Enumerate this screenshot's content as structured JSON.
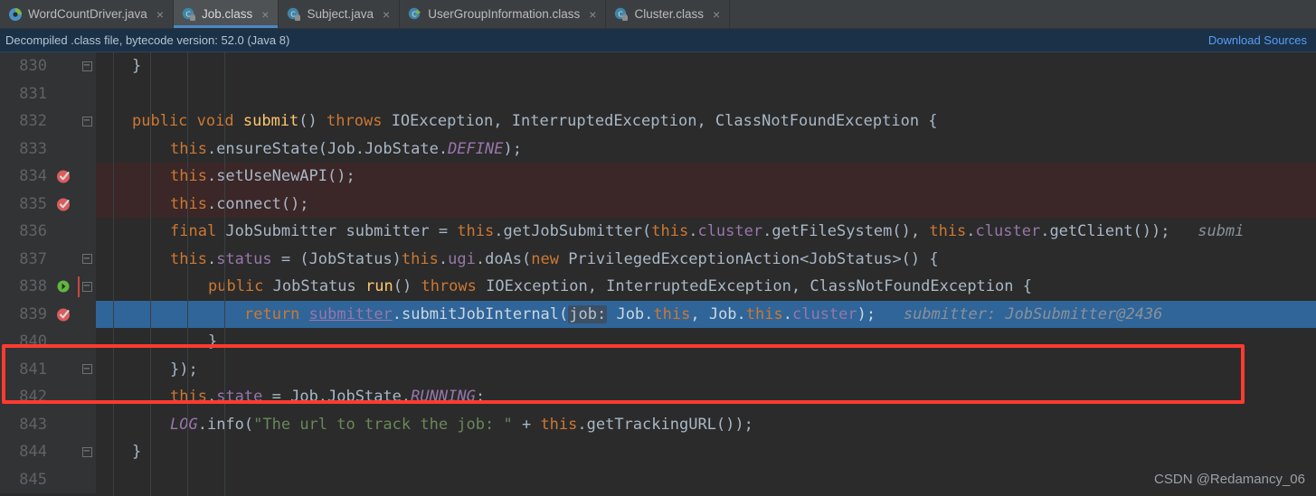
{
  "tabs": [
    {
      "label": "WordCountDriver.java",
      "icon": "java-file-icon",
      "active": false,
      "close": "×"
    },
    {
      "label": "Job.class",
      "icon": "class-file-icon",
      "active": true,
      "close": "×"
    },
    {
      "label": "Subject.java",
      "icon": "class-file-icon",
      "active": false,
      "close": "×"
    },
    {
      "label": "UserGroupInformation.class",
      "icon": "class-file-icon",
      "active": false,
      "close": "×"
    },
    {
      "label": "Cluster.class",
      "icon": "class-file-icon",
      "active": false,
      "close": "×"
    }
  ],
  "banner": {
    "message": "Decompiled .class file, bytecode version: 52.0 (Java 8)",
    "action_label": "Download Sources"
  },
  "editor": {
    "file": "Job.class",
    "first_line": 830,
    "lines": [
      {
        "n": "830",
        "fold": "minus",
        "breakpoint": null,
        "state": "normal"
      },
      {
        "n": "831",
        "fold": null,
        "breakpoint": null,
        "state": "normal"
      },
      {
        "n": "832",
        "fold": "minus",
        "breakpoint": null,
        "state": "normal"
      },
      {
        "n": "833",
        "fold": null,
        "breakpoint": null,
        "state": "normal"
      },
      {
        "n": "834",
        "fold": null,
        "breakpoint": "verified-red",
        "state": "error"
      },
      {
        "n": "835",
        "fold": null,
        "breakpoint": "verified-red",
        "state": "error"
      },
      {
        "n": "836",
        "fold": null,
        "breakpoint": null,
        "state": "normal"
      },
      {
        "n": "837",
        "fold": "minus",
        "breakpoint": null,
        "state": "normal"
      },
      {
        "n": "838",
        "fold": "minus",
        "breakpoint": "verified-green",
        "state": "normal"
      },
      {
        "n": "839",
        "fold": null,
        "breakpoint": "verified-red",
        "state": "selected"
      },
      {
        "n": "840",
        "fold": null,
        "breakpoint": null,
        "state": "normal"
      },
      {
        "n": "841",
        "fold": "minus",
        "breakpoint": null,
        "state": "normal"
      },
      {
        "n": "842",
        "fold": null,
        "breakpoint": null,
        "state": "normal"
      },
      {
        "n": "843",
        "fold": null,
        "breakpoint": null,
        "state": "normal"
      },
      {
        "n": "844",
        "fold": "minus",
        "breakpoint": null,
        "state": "normal"
      },
      {
        "n": "845",
        "fold": null,
        "breakpoint": null,
        "state": "normal"
      }
    ],
    "code": {
      "l830": "}",
      "l831": "",
      "l832_kw1": "public",
      "l832_kw2": "void",
      "l832_fn": "submit",
      "l832_paren": "()",
      "l832_kw3": "throws",
      "l832_rest": " IOException, InterruptedException, ClassNotFoundException {",
      "l833_this": "this",
      "l833_rest": ".ensureState(Job.JobState.",
      "l833_const": "DEFINE",
      "l833_end": ");",
      "l834_this": "this",
      "l834_rest": ".setUseNewAPI();",
      "l835_this": "this",
      "l835_rest": ".connect();",
      "l836_kw": "final",
      "l836_a": " JobSubmitter submitter = ",
      "l836_this1": "this",
      "l836_b": ".getJobSubmitter(",
      "l836_this2": "this",
      "l836_c": ".",
      "l836_fld1": "cluster",
      "l836_d": ".getFileSystem(), ",
      "l836_this3": "this",
      "l836_e": ".",
      "l836_fld2": "cluster",
      "l836_f": ".getClient());",
      "l836_hint": "submi",
      "l837_this1": "this",
      "l837_a": ".",
      "l837_fld1": "status",
      "l837_b": " = (JobStatus)",
      "l837_this2": "this",
      "l837_c": ".",
      "l837_fld2": "ugi",
      "l837_d": ".doAs(",
      "l837_kw": "new",
      "l837_e": " PrivilegedExceptionAction<JobStatus>() {",
      "l838_kw1": "public",
      "l838_a": " JobStatus ",
      "l838_fn": "run",
      "l838_b": "() ",
      "l838_kw2": "throws",
      "l838_c": " IOException, InterruptedException, ClassNotFoundException {",
      "l839_kw": "return",
      "l839_lnk": "submitter",
      "l839_a": ".submitJobInternal(",
      "l839_param": "job:",
      "l839_b": " Job.",
      "l839_this1": "this",
      "l839_c": ", Job.",
      "l839_this2": "this",
      "l839_d": ".",
      "l839_fld": "cluster",
      "l839_e": ");",
      "l839_hint": "submitter: JobSubmitter@2436",
      "l840": "}",
      "l841": "});",
      "l842_this": "this",
      "l842_a": ".",
      "l842_fld": "state",
      "l842_b": " = Job.JobState.",
      "l842_const": "RUNNING",
      "l842_c": ";",
      "l843_log": "LOG",
      "l843_a": ".info(",
      "l843_str": "\"The url to track the job: \"",
      "l843_b": " + ",
      "l843_this": "this",
      "l843_c": ".getTrackingURL());",
      "l844": "}"
    }
  },
  "watermark": "CSDN @Redamancy_06",
  "colors": {
    "background": "#2b2b2b",
    "gutter": "#313335",
    "tabbar": "#3c3f41",
    "tab_active": "#4e5254",
    "tab_underline": "#4a88c7",
    "banner_bg": "#1b3147",
    "banner_link": "#589df6",
    "selection": "#2f6599",
    "error_line": "#3b2727",
    "annotation_box": "#ff3b30",
    "keyword": "#cc7832",
    "method": "#ffc66d",
    "field": "#9876aa",
    "string": "#6a8759",
    "text": "#a9b7c6",
    "hint": "#8a9199"
  }
}
